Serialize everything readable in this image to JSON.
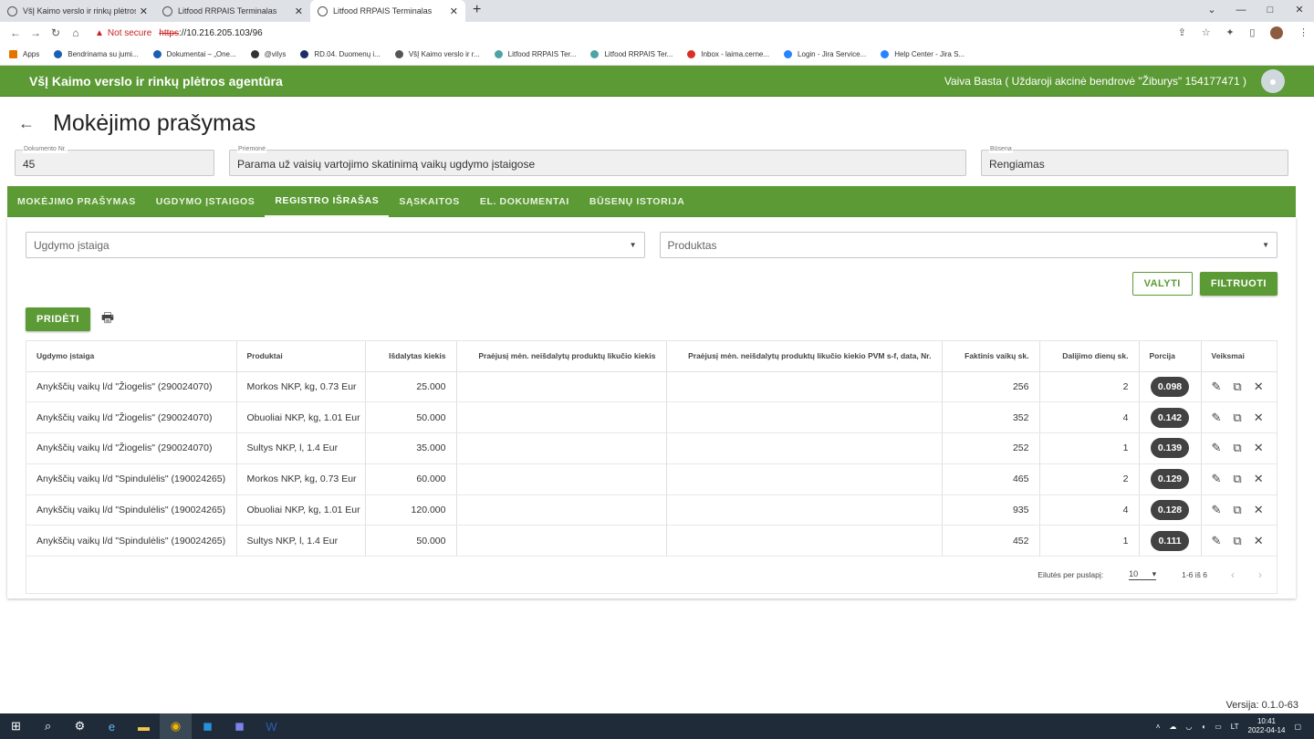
{
  "browser": {
    "tabs": [
      {
        "title": "VšĮ Kaimo verslo ir rinkų plėtros a"
      },
      {
        "title": "Litfood RRPAIS Terminalas"
      },
      {
        "title": "Litfood RRPAIS Terminalas"
      }
    ],
    "new_tab": "+",
    "security": "Not secure",
    "url_scheme": "https",
    "url_rest": "://10.216.205.103/96",
    "bookmarks": [
      "Apps",
      "Bendrinama su jumi...",
      "Dokumentai – „One...",
      "@vilys",
      "RD.04. Duomenų i...",
      "VšĮ Kaimo verslo ir r...",
      "Litfood RRPAIS Ter...",
      "Litfood RRPAIS Ter...",
      "Inbox - laima.cerne...",
      "Login - Jira Service...",
      "Help Center - Jira S..."
    ]
  },
  "app": {
    "title": "VšĮ Kaimo verslo ir rinkų plėtros agentūra",
    "user": "Vaiva Basta ( Uždaroji akcinė bendrovė \"Žiburys\" 154177471 )"
  },
  "page": {
    "title": "Mokėjimo prašymas",
    "fields": {
      "doc_label": "Dokumento Nr.",
      "doc_value": "45",
      "measure_label": "Priemonė",
      "measure_value": "Parama už vaisių vartojimo skatinimą vaikų ugdymo įstaigose",
      "status_label": "Būsena",
      "status_value": "Rengiamas"
    },
    "tabs": [
      "MOKĖJIMO PRAŠYMAS",
      "UGDYMO ĮSTAIGOS",
      "REGISTRO IŠRAŠAS",
      "SĄSKAITOS",
      "EL. DOKUMENTAI",
      "BŪSENŲ ISTORIJA"
    ],
    "active_tab": "REGISTRO IŠRAŠAS"
  },
  "filters": {
    "institution_placeholder": "Ugdymo įstaiga",
    "product_placeholder": "Produktas",
    "clear_label": "VALYTI",
    "filter_label": "FILTRUOTI",
    "add_label": "PRIDĖTI"
  },
  "table": {
    "columns": [
      "Ugdymo įstaiga",
      "Produktai",
      "Išdalytas kiekis",
      "Praėjusį mėn. neišdalytų produktų likučio kiekis",
      "Praėjusį mėn. neišdalytų produktų likučio kiekio PVM s-f, data, Nr.",
      "Faktinis vaikų sk.",
      "Dalijimo dienų sk.",
      "Porcija",
      "Veiksmai"
    ],
    "rows": [
      {
        "inst": "Anykščių vaikų l/d \"Žiogelis\" (290024070)",
        "prod": "Morkos NKP, kg, 0.73 Eur",
        "qty": "25.000",
        "rem": "",
        "vat": "",
        "kids": "256",
        "days": "2",
        "portion": "0.098"
      },
      {
        "inst": "Anykščių vaikų l/d \"Žiogelis\" (290024070)",
        "prod": "Obuoliai NKP, kg, 1.01 Eur",
        "qty": "50.000",
        "rem": "",
        "vat": "",
        "kids": "352",
        "days": "4",
        "portion": "0.142"
      },
      {
        "inst": "Anykščių vaikų l/d \"Žiogelis\" (290024070)",
        "prod": "Sultys NKP, l, 1.4 Eur",
        "qty": "35.000",
        "rem": "",
        "vat": "",
        "kids": "252",
        "days": "1",
        "portion": "0.139"
      },
      {
        "inst": "Anykščių vaikų l/d \"Spindulėlis\" (190024265)",
        "prod": "Morkos NKP, kg, 0.73 Eur",
        "qty": "60.000",
        "rem": "",
        "vat": "",
        "kids": "465",
        "days": "2",
        "portion": "0.129"
      },
      {
        "inst": "Anykščių vaikų l/d \"Spindulėlis\" (190024265)",
        "prod": "Obuoliai NKP, kg, 1.01 Eur",
        "qty": "120.000",
        "rem": "",
        "vat": "",
        "kids": "935",
        "days": "4",
        "portion": "0.128"
      },
      {
        "inst": "Anykščių vaikų l/d \"Spindulėlis\" (190024265)",
        "prod": "Sultys NKP, l, 1.4 Eur",
        "qty": "50.000",
        "rem": "",
        "vat": "",
        "kids": "452",
        "days": "1",
        "portion": "0.111"
      }
    ]
  },
  "pager": {
    "label": "Eilutės per puslapį:",
    "size": "10",
    "range": "1-6 iš 6"
  },
  "version": "Versija: 0.1.0-63",
  "taskbar": {
    "lang": "LT",
    "time": "10:41",
    "date": "2022-04-14"
  },
  "colors": {
    "brand": "#5b9a34",
    "chip": "#424242"
  }
}
